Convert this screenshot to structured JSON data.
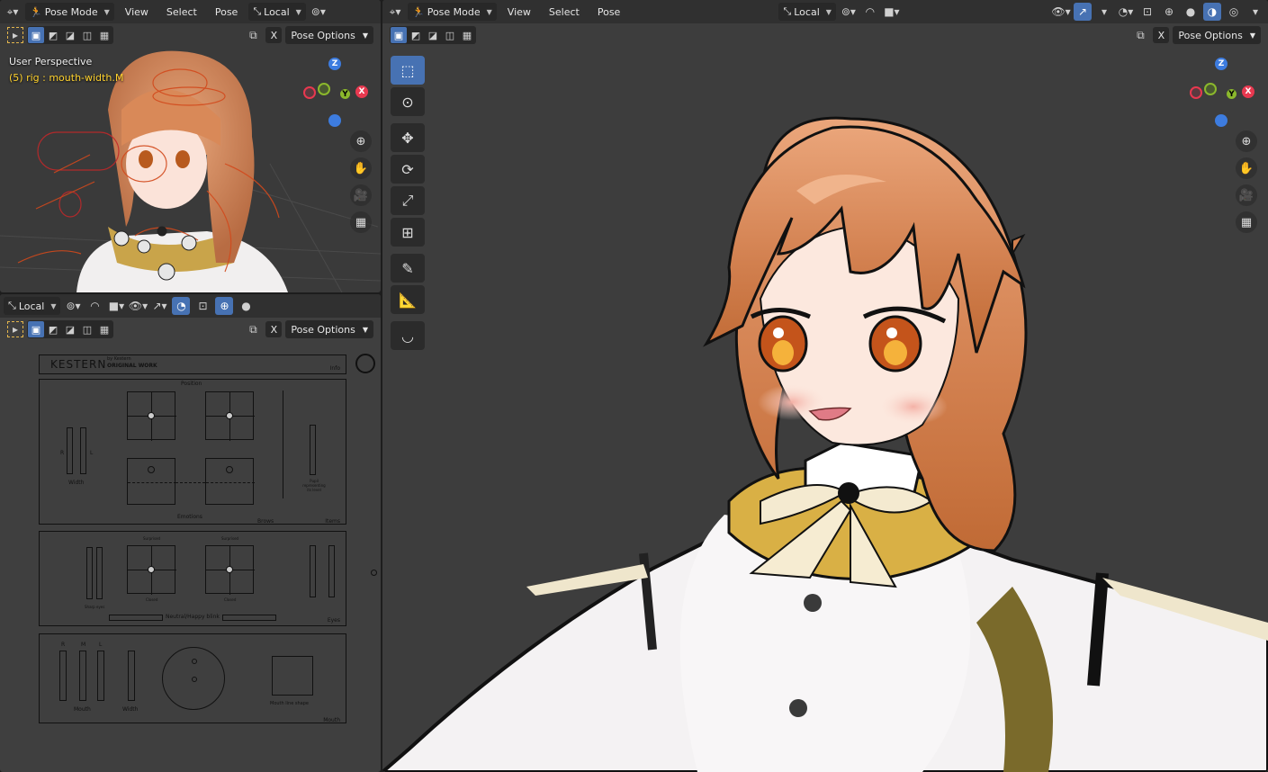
{
  "top_left": {
    "mode": "Pose Mode",
    "menus": [
      "View",
      "Select",
      "Pose"
    ],
    "pivot": "Local",
    "pose_options": "Pose Options",
    "x_label": "X",
    "view_label": "User Perspective",
    "selection_label": "(5) rig : mouth-width.M"
  },
  "bottom_left": {
    "pivot": "Local",
    "pose_options": "Pose Options",
    "x_label": "X",
    "panel": {
      "logo": "KESTERN",
      "logo_sub1": "by Kestern",
      "logo_sub2": "ORIGINAL WORK",
      "section_info": "Info",
      "position": "Position",
      "width": "Width",
      "emotions": "Emotions",
      "brows": "Brows",
      "items": "Items",
      "pupil_note": "Pupil representing its level",
      "surprised": "Surprised",
      "closed": "Closed",
      "neutral_happy": "Neutral/Happy blink",
      "eyes": "Eyes",
      "sharp_eyes": "Sharp eyes",
      "mouth_label": "Mouth",
      "mouth_line_shape": "Mouth line shape",
      "mouth_section": "Mouth",
      "r": "R",
      "m": "M",
      "l": "L"
    }
  },
  "main": {
    "mode": "Pose Mode",
    "menus": [
      "View",
      "Select",
      "Pose"
    ],
    "pivot": "Local",
    "pose_options": "Pose Options",
    "x_label": "X"
  },
  "colors": {
    "accent": "#4772b3",
    "x_axis": "#e8384f",
    "y_axis": "#8bb82c",
    "z_axis": "#3d7cdf",
    "selection_text": "#ffd22e"
  }
}
